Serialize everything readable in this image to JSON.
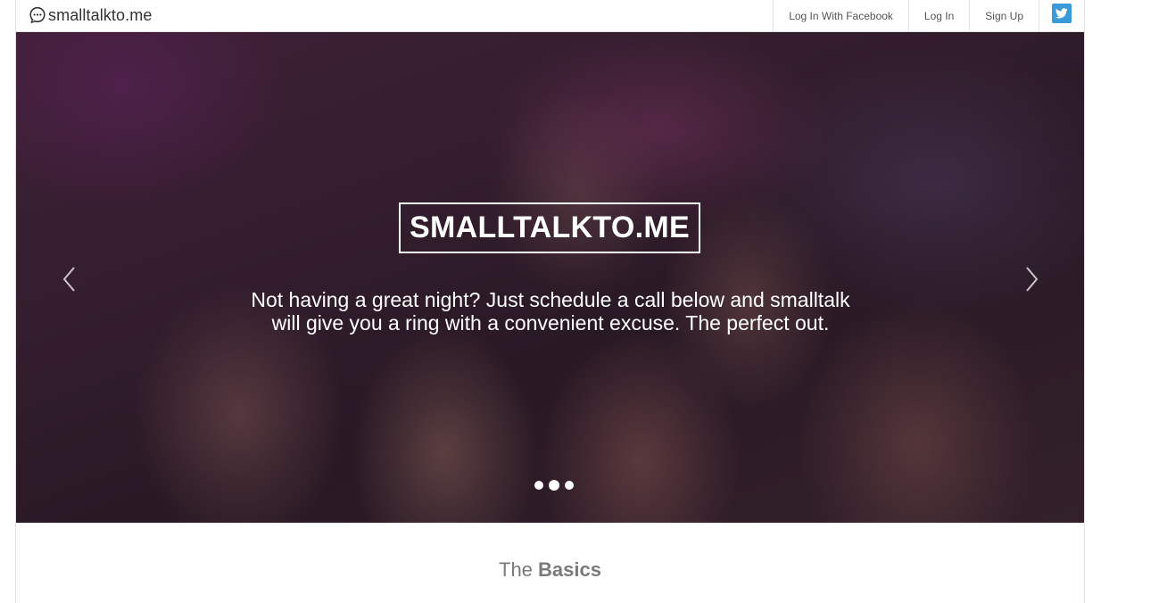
{
  "header": {
    "brand": "smalltalkto.me",
    "nav": [
      {
        "label": "Log In With Facebook"
      },
      {
        "label": "Log In"
      },
      {
        "label": "Sign Up"
      }
    ],
    "twitter_icon": "twitter-icon"
  },
  "hero": {
    "title": "SMALLTALKTO.ME",
    "subtitle_line1": "Not having a great night? Just schedule a call below and smalltalk",
    "subtitle_line2": "will give you a ring with a convenient excuse. The perfect out.",
    "slides_count": 3,
    "active_slide": 2
  },
  "section": {
    "heading_prefix": "The",
    "heading_emphasis": "Basics"
  },
  "colors": {
    "twitter_blue": "#3a9bd8",
    "heading_gray": "#7a7a7a"
  }
}
